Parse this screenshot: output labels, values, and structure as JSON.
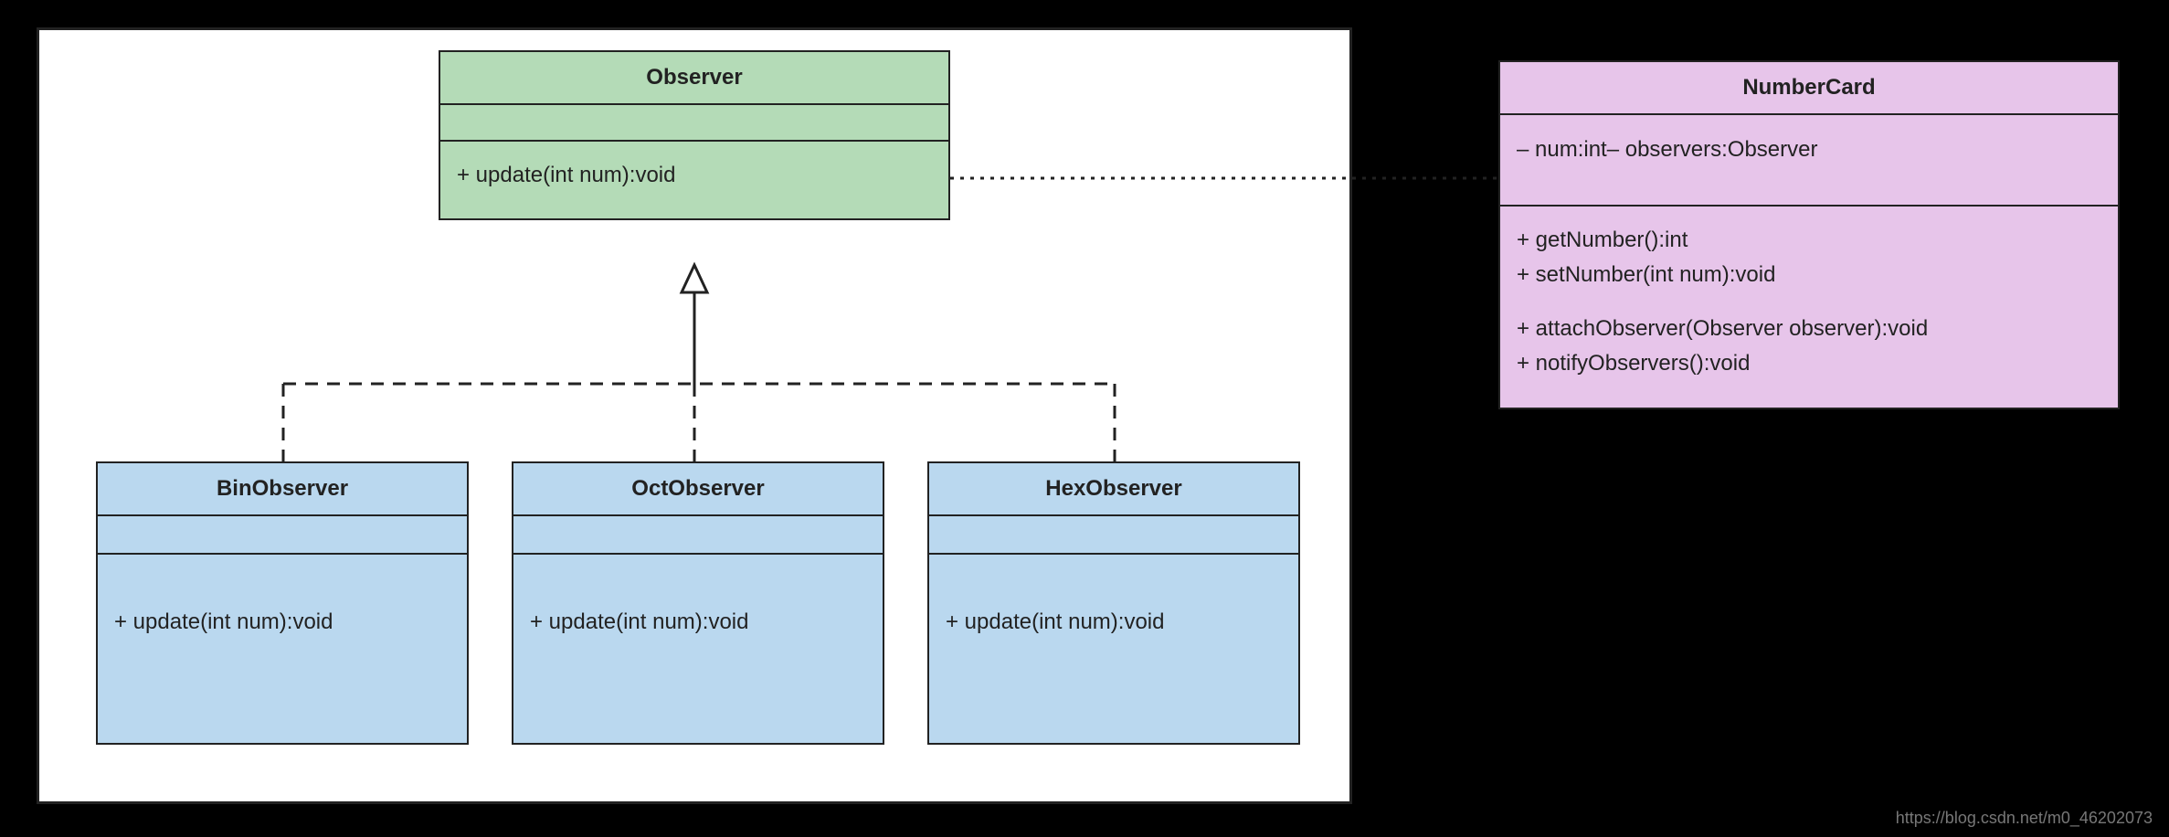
{
  "observer": {
    "title": "Observer",
    "method1": "+ update(int num):void"
  },
  "bin": {
    "title": "BinObserver",
    "method1": "+ update(int num):void"
  },
  "oct": {
    "title": "OctObserver",
    "method1": "+ update(int num):void"
  },
  "hex": {
    "title": "HexObserver",
    "method1": "+ update(int num):void"
  },
  "numbercard": {
    "title": "NumberCard",
    "attr1": "– num:int– observers:Observer",
    "method1": "+ getNumber():int",
    "method2": "+ setNumber(int num):void",
    "method3": "+ attachObserver(Observer observer):void",
    "method4": "+ notifyObservers():void"
  },
  "watermark": "https://blog.csdn.net/m0_46202073"
}
